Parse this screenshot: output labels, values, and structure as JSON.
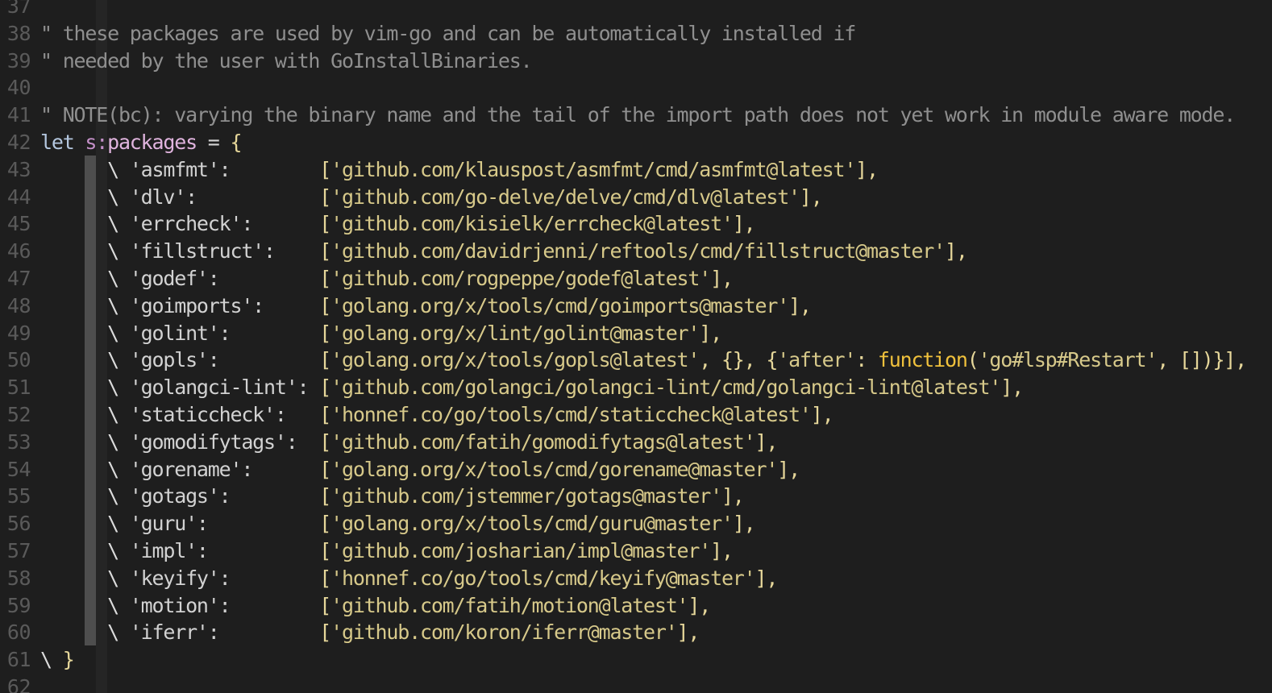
{
  "editor": {
    "language": "vim",
    "lines": [
      {
        "number": "37",
        "tokens": []
      },
      {
        "number": "38",
        "tokens": [
          {
            "cls": "comment",
            "text": "\" these packages are used by vim-go and can be automatically installed if"
          }
        ]
      },
      {
        "number": "39",
        "tokens": [
          {
            "cls": "comment",
            "text": "\" needed by the user with GoInstallBinaries."
          }
        ]
      },
      {
        "number": "40",
        "tokens": []
      },
      {
        "number": "41",
        "tokens": [
          {
            "cls": "comment",
            "text": "\" NOTE(bc): varying the binary name and the tail of the import path does not yet work in module aware mode."
          }
        ]
      },
      {
        "number": "42",
        "tokens": [
          {
            "cls": "keyword",
            "text": "let "
          },
          {
            "cls": "scope",
            "text": "s:"
          },
          {
            "cls": "ident",
            "text": "packages"
          },
          {
            "cls": "op",
            "text": " = "
          },
          {
            "cls": "punct",
            "text": "{"
          }
        ]
      },
      {
        "number": "43",
        "tokens": [
          {
            "cls": "text",
            "text": "      "
          },
          {
            "cls": "continuation",
            "text": "\\ "
          },
          {
            "cls": "key",
            "text": "'asmfmt':        "
          },
          {
            "cls": "punct",
            "text": "["
          },
          {
            "cls": "string",
            "text": "'github.com/klauspost/asmfmt/cmd/asmfmt@latest'"
          },
          {
            "cls": "punct",
            "text": "],"
          }
        ]
      },
      {
        "number": "44",
        "tokens": [
          {
            "cls": "text",
            "text": "      "
          },
          {
            "cls": "continuation",
            "text": "\\ "
          },
          {
            "cls": "key",
            "text": "'dlv':           "
          },
          {
            "cls": "punct",
            "text": "["
          },
          {
            "cls": "string",
            "text": "'github.com/go-delve/delve/cmd/dlv@latest'"
          },
          {
            "cls": "punct",
            "text": "],"
          }
        ]
      },
      {
        "number": "45",
        "tokens": [
          {
            "cls": "text",
            "text": "      "
          },
          {
            "cls": "continuation",
            "text": "\\ "
          },
          {
            "cls": "key",
            "text": "'errcheck':      "
          },
          {
            "cls": "punct",
            "text": "["
          },
          {
            "cls": "string",
            "text": "'github.com/kisielk/errcheck@latest'"
          },
          {
            "cls": "punct",
            "text": "],"
          }
        ]
      },
      {
        "number": "46",
        "tokens": [
          {
            "cls": "text",
            "text": "      "
          },
          {
            "cls": "continuation",
            "text": "\\ "
          },
          {
            "cls": "key",
            "text": "'fillstruct':    "
          },
          {
            "cls": "punct",
            "text": "["
          },
          {
            "cls": "string",
            "text": "'github.com/davidrjenni/reftools/cmd/fillstruct@master'"
          },
          {
            "cls": "punct",
            "text": "],"
          }
        ]
      },
      {
        "number": "47",
        "tokens": [
          {
            "cls": "text",
            "text": "      "
          },
          {
            "cls": "continuation",
            "text": "\\ "
          },
          {
            "cls": "key",
            "text": "'godef':         "
          },
          {
            "cls": "punct",
            "text": "["
          },
          {
            "cls": "string",
            "text": "'github.com/rogpeppe/godef@latest'"
          },
          {
            "cls": "punct",
            "text": "],"
          }
        ]
      },
      {
        "number": "48",
        "tokens": [
          {
            "cls": "text",
            "text": "      "
          },
          {
            "cls": "continuation",
            "text": "\\ "
          },
          {
            "cls": "key",
            "text": "'goimports':     "
          },
          {
            "cls": "punct",
            "text": "["
          },
          {
            "cls": "string",
            "text": "'golang.org/x/tools/cmd/goimports@master'"
          },
          {
            "cls": "punct",
            "text": "],"
          }
        ]
      },
      {
        "number": "49",
        "tokens": [
          {
            "cls": "text",
            "text": "      "
          },
          {
            "cls": "continuation",
            "text": "\\ "
          },
          {
            "cls": "key",
            "text": "'golint':        "
          },
          {
            "cls": "punct",
            "text": "["
          },
          {
            "cls": "string",
            "text": "'golang.org/x/lint/golint@master'"
          },
          {
            "cls": "punct",
            "text": "],"
          }
        ]
      },
      {
        "number": "50",
        "tokens": [
          {
            "cls": "text",
            "text": "      "
          },
          {
            "cls": "continuation",
            "text": "\\ "
          },
          {
            "cls": "key",
            "text": "'gopls':         "
          },
          {
            "cls": "punct",
            "text": "["
          },
          {
            "cls": "string",
            "text": "'golang.org/x/tools/gopls@latest'"
          },
          {
            "cls": "punct",
            "text": ", {}, {"
          },
          {
            "cls": "string",
            "text": "'after'"
          },
          {
            "cls": "punct",
            "text": ": "
          },
          {
            "cls": "func",
            "text": "function"
          },
          {
            "cls": "punct",
            "text": "("
          },
          {
            "cls": "string",
            "text": "'go#lsp#Restart'"
          },
          {
            "cls": "punct",
            "text": ", [])}],"
          }
        ]
      },
      {
        "number": "51",
        "tokens": [
          {
            "cls": "text",
            "text": "      "
          },
          {
            "cls": "continuation",
            "text": "\\ "
          },
          {
            "cls": "key",
            "text": "'golangci-lint': "
          },
          {
            "cls": "punct",
            "text": "["
          },
          {
            "cls": "string",
            "text": "'github.com/golangci/golangci-lint/cmd/golangci-lint@latest'"
          },
          {
            "cls": "punct",
            "text": "],"
          }
        ]
      },
      {
        "number": "52",
        "tokens": [
          {
            "cls": "text",
            "text": "      "
          },
          {
            "cls": "continuation",
            "text": "\\ "
          },
          {
            "cls": "key",
            "text": "'staticcheck':   "
          },
          {
            "cls": "punct",
            "text": "["
          },
          {
            "cls": "string",
            "text": "'honnef.co/go/tools/cmd/staticcheck@latest'"
          },
          {
            "cls": "punct",
            "text": "],"
          }
        ]
      },
      {
        "number": "53",
        "tokens": [
          {
            "cls": "text",
            "text": "      "
          },
          {
            "cls": "continuation",
            "text": "\\ "
          },
          {
            "cls": "key",
            "text": "'gomodifytags':  "
          },
          {
            "cls": "punct",
            "text": "["
          },
          {
            "cls": "string",
            "text": "'github.com/fatih/gomodifytags@latest'"
          },
          {
            "cls": "punct",
            "text": "],"
          }
        ]
      },
      {
        "number": "54",
        "tokens": [
          {
            "cls": "text",
            "text": "      "
          },
          {
            "cls": "continuation",
            "text": "\\ "
          },
          {
            "cls": "key",
            "text": "'gorename':      "
          },
          {
            "cls": "punct",
            "text": "["
          },
          {
            "cls": "string",
            "text": "'golang.org/x/tools/cmd/gorename@master'"
          },
          {
            "cls": "punct",
            "text": "],"
          }
        ]
      },
      {
        "number": "55",
        "tokens": [
          {
            "cls": "text",
            "text": "      "
          },
          {
            "cls": "continuation",
            "text": "\\ "
          },
          {
            "cls": "key",
            "text": "'gotags':        "
          },
          {
            "cls": "punct",
            "text": "["
          },
          {
            "cls": "string",
            "text": "'github.com/jstemmer/gotags@master'"
          },
          {
            "cls": "punct",
            "text": "],"
          }
        ]
      },
      {
        "number": "56",
        "tokens": [
          {
            "cls": "text",
            "text": "      "
          },
          {
            "cls": "continuation",
            "text": "\\ "
          },
          {
            "cls": "key",
            "text": "'guru':          "
          },
          {
            "cls": "punct",
            "text": "["
          },
          {
            "cls": "string",
            "text": "'golang.org/x/tools/cmd/guru@master'"
          },
          {
            "cls": "punct",
            "text": "],"
          }
        ]
      },
      {
        "number": "57",
        "tokens": [
          {
            "cls": "text",
            "text": "      "
          },
          {
            "cls": "continuation",
            "text": "\\ "
          },
          {
            "cls": "key",
            "text": "'impl':          "
          },
          {
            "cls": "punct",
            "text": "["
          },
          {
            "cls": "string",
            "text": "'github.com/josharian/impl@master'"
          },
          {
            "cls": "punct",
            "text": "],"
          }
        ]
      },
      {
        "number": "58",
        "tokens": [
          {
            "cls": "text",
            "text": "      "
          },
          {
            "cls": "continuation",
            "text": "\\ "
          },
          {
            "cls": "key",
            "text": "'keyify':        "
          },
          {
            "cls": "punct",
            "text": "["
          },
          {
            "cls": "string",
            "text": "'honnef.co/go/tools/cmd/keyify@master'"
          },
          {
            "cls": "punct",
            "text": "],"
          }
        ]
      },
      {
        "number": "59",
        "tokens": [
          {
            "cls": "text",
            "text": "      "
          },
          {
            "cls": "continuation",
            "text": "\\ "
          },
          {
            "cls": "key",
            "text": "'motion':        "
          },
          {
            "cls": "punct",
            "text": "["
          },
          {
            "cls": "string",
            "text": "'github.com/fatih/motion@latest'"
          },
          {
            "cls": "punct",
            "text": "],"
          }
        ]
      },
      {
        "number": "60",
        "tokens": [
          {
            "cls": "text",
            "text": "      "
          },
          {
            "cls": "continuation",
            "text": "\\ "
          },
          {
            "cls": "key",
            "text": "'iferr':         "
          },
          {
            "cls": "punct",
            "text": "["
          },
          {
            "cls": "string",
            "text": "'github.com/koron/iferr@master'"
          },
          {
            "cls": "punct",
            "text": "],"
          }
        ]
      },
      {
        "number": "61",
        "tokens": [
          {
            "cls": "continuation",
            "text": "\\ "
          },
          {
            "cls": "punct",
            "text": "}"
          }
        ]
      },
      {
        "number": "62",
        "tokens": []
      }
    ]
  },
  "theme": {
    "background": "#1e1e1e",
    "gutter": "#5a5a5a",
    "comment": "#8f8f8f",
    "keyword": "#b4c7df",
    "string": "#d7c98a",
    "function": "#f0c13c",
    "indent_guide_active": "#4e4e4e"
  }
}
